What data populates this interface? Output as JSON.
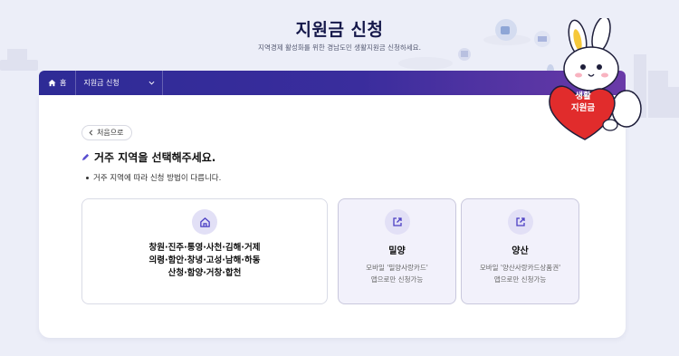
{
  "header": {
    "title": "지원금 신청",
    "subtitle": "지역경제 활성화를 위한 경남도민 생활지원금 신청하세요."
  },
  "nav": {
    "home_label": "홈",
    "dropdown_label": "지원금 신청"
  },
  "back_button": {
    "label": "처음으로"
  },
  "section": {
    "title": "거주 지역을 선택해주세요.",
    "notice": "거주 지역에 따라 신청 방법이 다릅니다."
  },
  "regions": {
    "main": {
      "icon": "home-icon",
      "line1": "창원·진주·통영·사천·김해·거제",
      "line2": "의령·함안·창녕·고성·남해·하동",
      "line3": "산청·함양·거창·합천"
    },
    "miryang": {
      "icon": "external-link-icon",
      "name": "밀양",
      "desc1": "모바일 '밀양사랑카드'",
      "desc2": "앱으로만 신청가능"
    },
    "yangsan": {
      "icon": "external-link-icon",
      "name": "양산",
      "desc1": "모바일 '양산사랑카드상품권'",
      "desc2": "앱으로만 신청가능"
    }
  },
  "mascot": {
    "badge_line1": "생활",
    "badge_line2": "지원금"
  },
  "colors": {
    "nav_start": "#2e2b96",
    "nav_end": "#6a3aa8",
    "accent": "#4b3fc4",
    "badge": "#e12c2c"
  }
}
